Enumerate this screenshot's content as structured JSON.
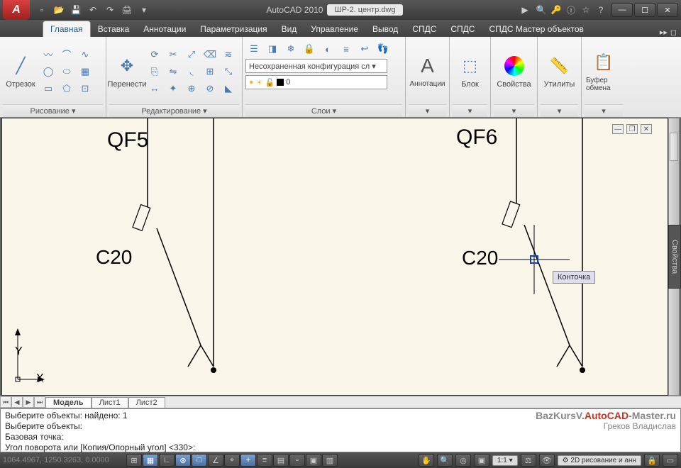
{
  "title": {
    "app": "AutoCAD 2010",
    "file": "ШР-2. центр.dwg"
  },
  "qat": [
    "new",
    "open",
    "save",
    "undo",
    "redo",
    "plot",
    "separator",
    "undo-arrow",
    "redo-arrow"
  ],
  "info_center_label": "",
  "tabs": {
    "items": [
      "Главная",
      "Вставка",
      "Аннотации",
      "Параметризация",
      "Вид",
      "Управление",
      "Вывод",
      "СПДС",
      "СПДС",
      "СПДС Мастер объектов"
    ],
    "active": 0,
    "overflow": "▸▸"
  },
  "ribbon": {
    "draw": {
      "big": "Отрезок",
      "title": "Рисование ▾"
    },
    "modify": {
      "big": "Перенести",
      "title": "Редактирование ▾"
    },
    "layers": {
      "combo1": "Несохраненная конфигурация сл ▾",
      "combo2_value": "0",
      "title": "Слои ▾"
    },
    "annot": {
      "label": "Аннотации",
      "title": "▾"
    },
    "block": {
      "label": "Блок",
      "title": "▾"
    },
    "props": {
      "label": "Свойства",
      "title": "▾"
    },
    "utils": {
      "label": "Утилиты",
      "title": "▾"
    },
    "clip": {
      "label": "Буфер обмена",
      "title": "▾"
    }
  },
  "canvas": {
    "labels": {
      "qf5": "QF5",
      "qf6": "QF6",
      "c20a": "C20",
      "c20b": "C20"
    },
    "tooltip": "Конточка",
    "ucs": {
      "x": "X",
      "y": "Y"
    }
  },
  "model_tabs": {
    "items": [
      "Модель",
      "Лист1",
      "Лист2"
    ],
    "active": 0
  },
  "cmd": {
    "lines": [
      "Выберите объекты: найдено: 1",
      "Выберите объекты:",
      "Базовая точка:",
      "Угол поворота или [Копия/Опорный угол] <330>:"
    ]
  },
  "watermark": {
    "part1": "BazKursV.",
    "part2": "AutoCAD",
    "part3": "-Master.ru",
    "sub": "Греков Владислав"
  },
  "status": {
    "coords": "1064.4967, 1250.3263, 0.0000",
    "workspace": "2D рисование и анн",
    "scale": "1:1 ▾"
  },
  "side_panel": "Свойства"
}
